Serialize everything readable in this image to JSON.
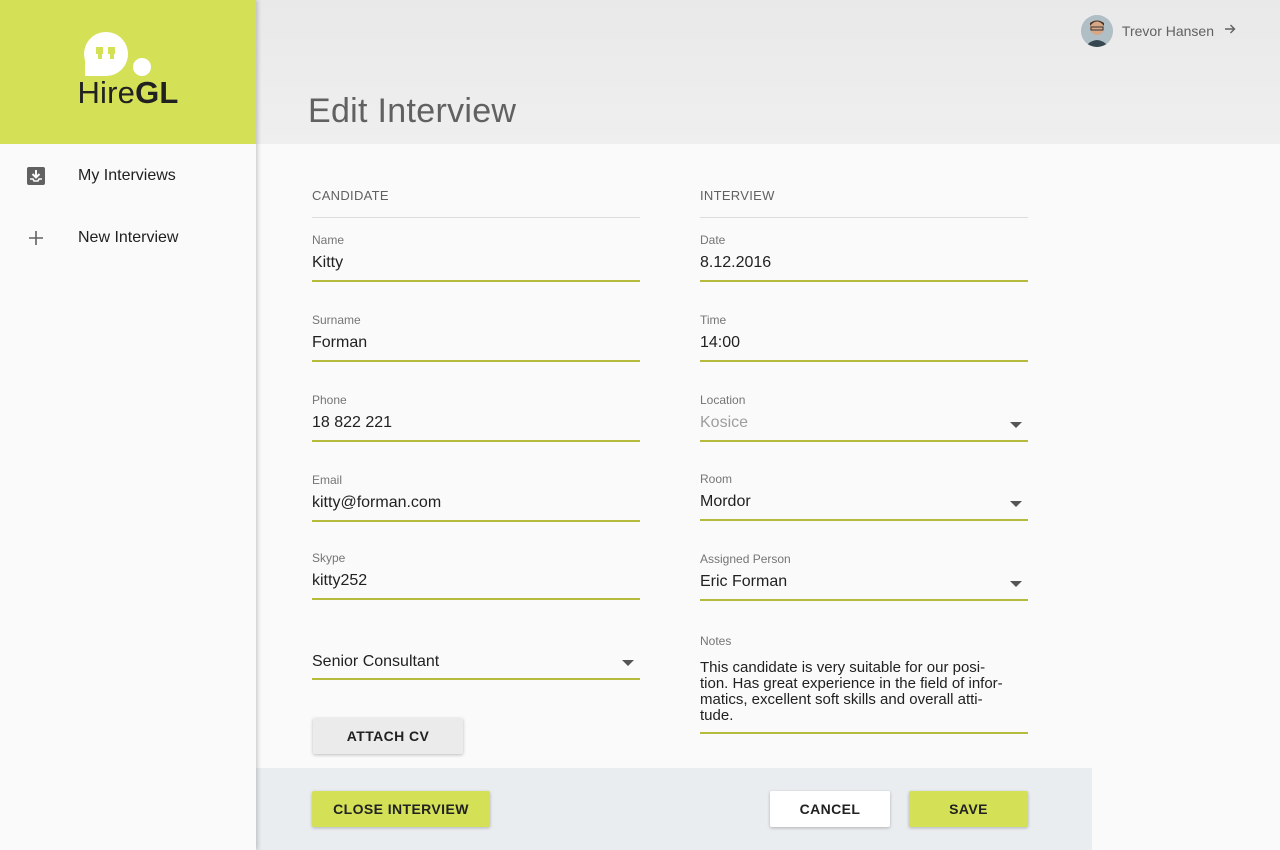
{
  "app": {
    "name_regular": "Hire",
    "name_bold": "GL"
  },
  "sidebar": {
    "items": [
      {
        "label": "My Interviews",
        "icon": "inbox-download-icon"
      },
      {
        "label": "New Interview",
        "icon": "plus-icon"
      }
    ]
  },
  "header": {
    "title": "Edit Interview",
    "user": {
      "name": "Trevor Hansen",
      "action_icon": "arrow-right-icon"
    }
  },
  "candidate": {
    "heading": "CANDIDATE",
    "name": {
      "label": "Name",
      "value": "Kitty"
    },
    "surname": {
      "label": "Surname",
      "value": "Forman"
    },
    "phone": {
      "label": "Phone",
      "value": "18 822 221"
    },
    "email": {
      "label": "Email",
      "value": "kitty@forman.com"
    },
    "skype": {
      "label": "Skype",
      "value": "kitty252"
    },
    "position": {
      "value": "Senior Consultant"
    },
    "attach_cv": "ATTACH CV"
  },
  "interview": {
    "heading": "INTERVIEW",
    "date": {
      "label": "Date",
      "value": "8.12.2016"
    },
    "time": {
      "label": "Time",
      "value": "14:00"
    },
    "location": {
      "label": "Location",
      "value": "Kosice"
    },
    "room": {
      "label": "Room",
      "value": "Mordor"
    },
    "assigned": {
      "label": "Assigned Person",
      "value": "Eric Forman"
    },
    "notes": {
      "label": "Notes",
      "line1": "This candidate is very suitable for our posi-",
      "line2": "tion. Has great experience in the field of infor-",
      "line3": "matics, excellent soft skills and overall atti-",
      "line4": "tude."
    }
  },
  "actions": {
    "close": "CLOSE INTERVIEW",
    "cancel": "CANCEL",
    "save": "SAVE"
  },
  "colors": {
    "accent": "#d4e157",
    "underline": "#b5bb3a",
    "footer_bg": "#eaedf0"
  }
}
